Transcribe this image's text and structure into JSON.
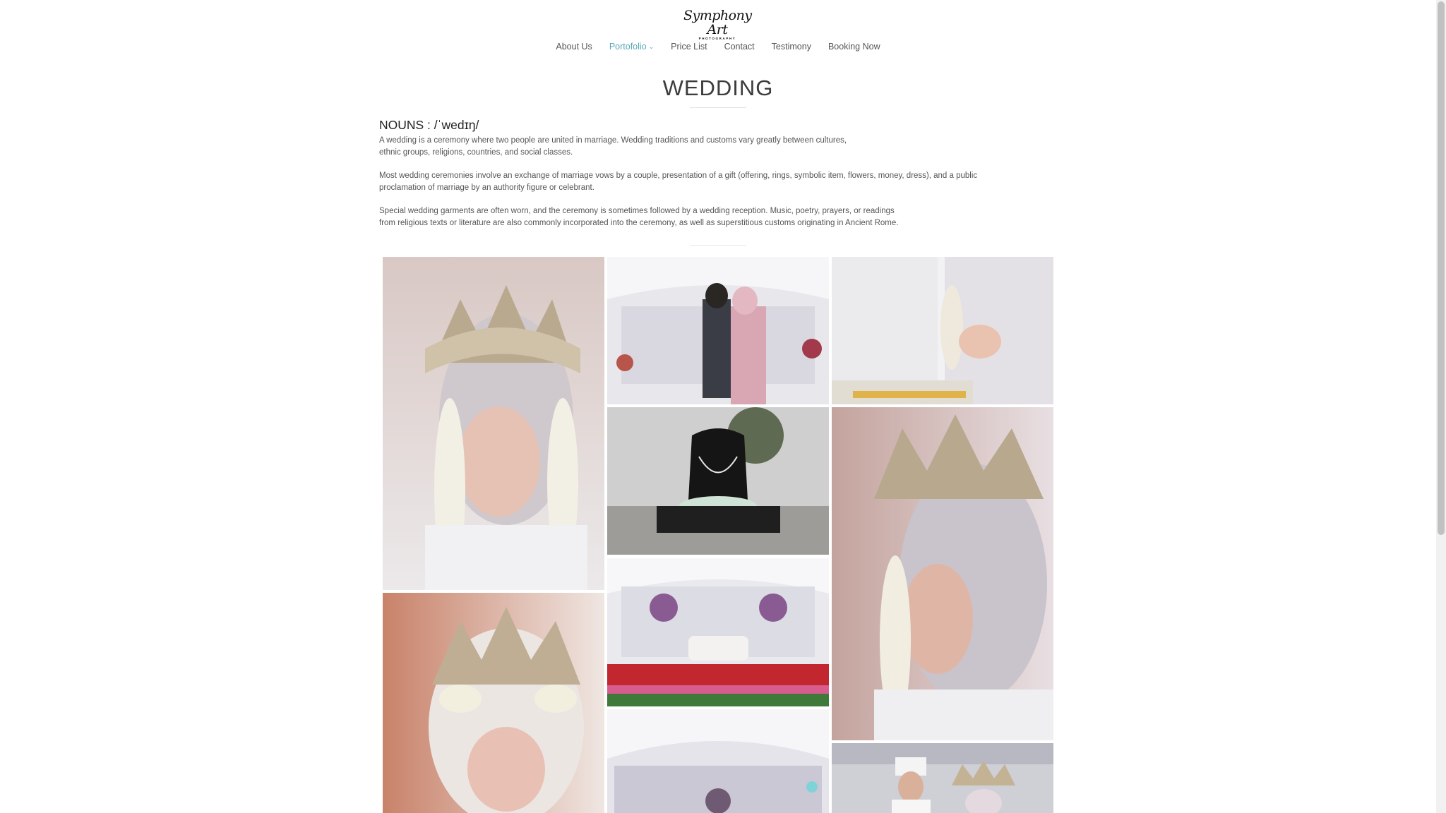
{
  "logo": {
    "script": "Symphony Art",
    "sub": "PHOTOGRAPHY"
  },
  "nav": {
    "items": [
      {
        "label": "About Us"
      },
      {
        "label": "Portofolio",
        "active": true,
        "has_dropdown": true
      },
      {
        "label": "Price List"
      },
      {
        "label": "Contact"
      },
      {
        "label": "Testimony"
      },
      {
        "label": "Booking Now"
      }
    ]
  },
  "page": {
    "title": "WEDDING",
    "nouns": "NOUNS : /ˈwedɪŋ/",
    "paragraphs": [
      "A wedding is a ceremony where two people are united in marriage. Wedding traditions and customs vary greatly between cultures,\nethnic groups, religions, countries, and social classes.",
      "Most wedding ceremonies involve an exchange of marriage vows by a couple, presentation of a gift (offering, rings, symbolic item, flowers, money, dress), and a public\nproclamation of marriage by an authority figure or celebrant.",
      "Special wedding garments are often worn, and the ceremony is sometimes followed by a wedding reception. Music, poetry, prayers, or readings\nfrom religious texts or literature are also commonly incorporated into the ceremony, as well as superstitious customs originating in Ancient Rome."
    ]
  },
  "gallery": {
    "photos": [
      {
        "name": "bride-crown-portrait"
      },
      {
        "name": "couple-kiss-decor"
      },
      {
        "name": "couple-hands-ring"
      },
      {
        "name": "necklace-display"
      },
      {
        "name": "bride-profile-crown"
      },
      {
        "name": "wedding-stage-decor"
      },
      {
        "name": "bride-smiling-crown"
      },
      {
        "name": "feather-ceiling-decor"
      },
      {
        "name": "couple-standing"
      }
    ]
  },
  "colors": {
    "accent": "#58a8b4",
    "text": "#555555",
    "title": "#3c3c3c"
  }
}
